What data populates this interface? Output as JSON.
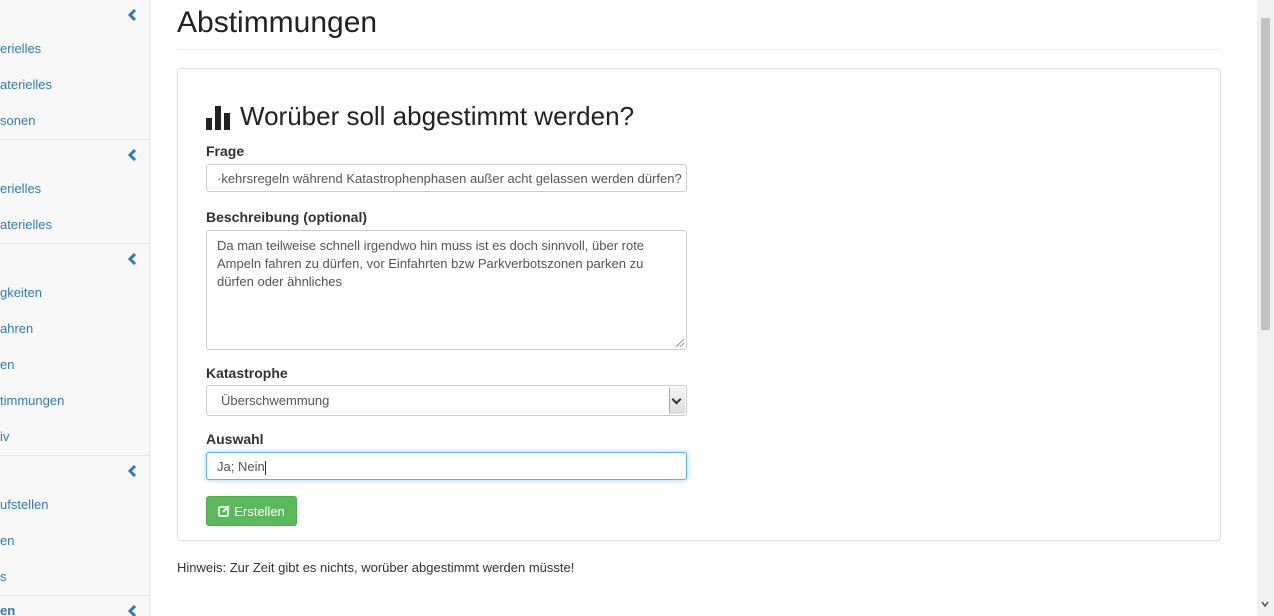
{
  "sidebar": {
    "sections": [
      {
        "items": [
          "erielles",
          "aterielles",
          "sonen"
        ]
      },
      {
        "items": [
          "erielles",
          "aterielles"
        ]
      },
      {
        "items": [
          "gkeiten",
          "ahren",
          "en",
          "timmungen",
          "iv"
        ]
      },
      {
        "items": [
          "ufstellen",
          "en",
          "s"
        ]
      },
      {
        "items": [
          "en"
        ]
      }
    ]
  },
  "page": {
    "title": "Abstimmungen"
  },
  "form": {
    "heading": "Worüber soll abgestimmt werden?",
    "frage_label": "Frage",
    "frage_value": "·kehrsregeln während Katastrophenphasen außer acht gelassen werden dürfen?",
    "beschreibung_label": "Beschreibung (optional)",
    "beschreibung_value": "Da man teilweise schnell irgendwo hin muss ist es doch sinnvoll, über rote Ampeln fahren zu dürfen, vor Einfahrten bzw Parkverbotszonen parken zu dürfen oder ähnliches",
    "katastrophe_label": "Katastrophe",
    "katastrophe_value": "Überschwemmung",
    "auswahl_label": "Auswahl",
    "auswahl_value": "Ja; Nein",
    "submit_label": "Erstellen"
  },
  "hint": "Hinweis: Zur Zeit gibt es nichts, worüber abgestimmt werden müsste!",
  "colors": {
    "link": "#337ab7",
    "success": "#5cb85c",
    "focus": "#66afe9"
  },
  "icons": {
    "chart": "bar-chart-icon",
    "section_toggle": "chevron-left-icon",
    "submit": "edit-icon"
  }
}
